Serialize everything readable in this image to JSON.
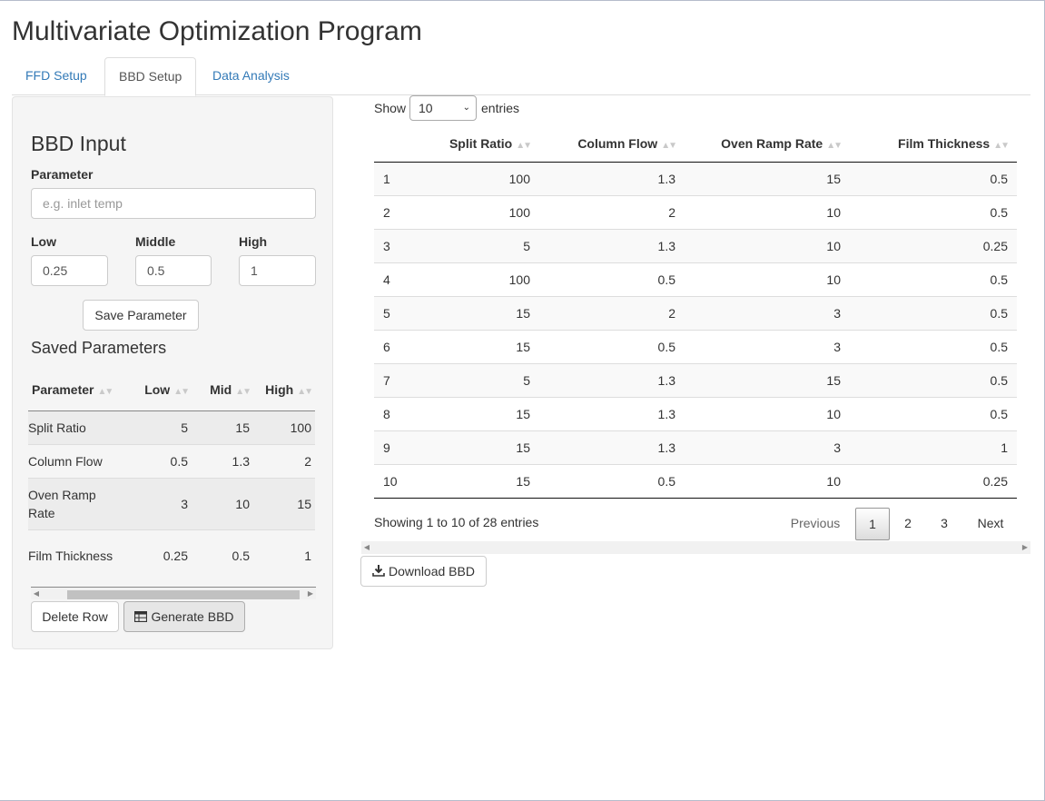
{
  "app": {
    "title": "Multivariate Optimization Program"
  },
  "tabs": [
    {
      "label": "FFD Setup"
    },
    {
      "label": "BBD Setup"
    },
    {
      "label": "Data Analysis"
    }
  ],
  "sidebar": {
    "title": "BBD Input",
    "parameter": {
      "label": "Parameter",
      "placeholder": "e.g. inlet temp",
      "value": ""
    },
    "low": {
      "label": "Low",
      "value": "0.25"
    },
    "middle": {
      "label": "Middle",
      "value": "0.5"
    },
    "high": {
      "label": "High",
      "value": "1"
    },
    "save_button": "Save Parameter",
    "saved_title": "Saved Parameters",
    "saved_table": {
      "headers": [
        "Parameter",
        "Low",
        "Mid",
        "High"
      ],
      "rows": [
        [
          "Split Ratio",
          "5",
          "15",
          "100"
        ],
        [
          "Column Flow",
          "0.5",
          "1.3",
          "2"
        ],
        [
          "Oven Ramp Rate",
          "3",
          "10",
          "15"
        ],
        [
          "Film Thickness",
          "0.25",
          "0.5",
          "1"
        ]
      ]
    },
    "delete_button": "Delete Row",
    "generate_button": "Generate BBD",
    "generate_icon": "table-icon"
  },
  "main": {
    "show_label": "Show",
    "entries_value": "10",
    "entries_label": "entries",
    "table": {
      "headers": [
        "",
        "Split Ratio",
        "Column Flow",
        "Oven Ramp Rate",
        "Film Thickness"
      ],
      "rows": [
        [
          "1",
          "100",
          "1.3",
          "15",
          "0.5"
        ],
        [
          "2",
          "100",
          "2",
          "10",
          "0.5"
        ],
        [
          "3",
          "5",
          "1.3",
          "10",
          "0.25"
        ],
        [
          "4",
          "100",
          "0.5",
          "10",
          "0.5"
        ],
        [
          "5",
          "15",
          "2",
          "3",
          "0.5"
        ],
        [
          "6",
          "15",
          "0.5",
          "3",
          "0.5"
        ],
        [
          "7",
          "5",
          "1.3",
          "15",
          "0.5"
        ],
        [
          "8",
          "15",
          "1.3",
          "10",
          "0.5"
        ],
        [
          "9",
          "15",
          "1.3",
          "3",
          "1"
        ],
        [
          "10",
          "15",
          "0.5",
          "10",
          "0.25"
        ]
      ]
    },
    "info": "Showing 1 to 10 of 28 entries",
    "pagination": {
      "previous": "Previous",
      "pages": [
        "1",
        "2",
        "3"
      ],
      "current": "1",
      "next": "Next"
    },
    "download_button": "Download BBD",
    "download_icon": "download-icon"
  }
}
